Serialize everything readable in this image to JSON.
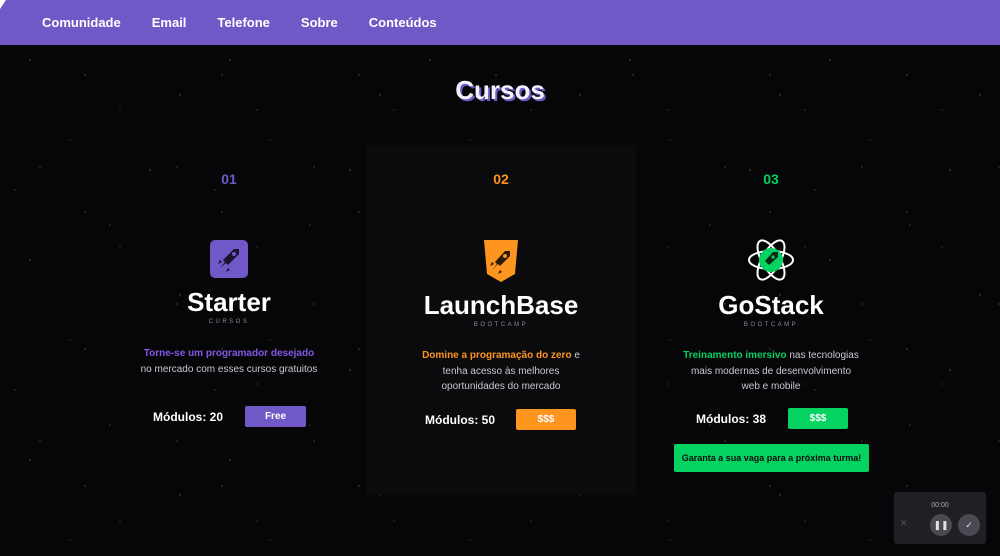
{
  "nav": {
    "items": [
      "Comunidade",
      "Email",
      "Telefone",
      "Sobre",
      "Conteúdos"
    ]
  },
  "page_title": "Cursos",
  "colors": {
    "navbar": "#7158c7",
    "starter_accent": "#8257e5",
    "launchbase_accent": "#fd951f",
    "gostack_accent": "#04d361"
  },
  "courses": [
    {
      "number": "01",
      "icon": "rocket-square-icon",
      "name": "Starter",
      "subtitle": "CURSOS",
      "desc_highlight": "Torne-se um programador desejado",
      "desc_rest": " no mercado com esses cursos gratuitos",
      "modules": "Módulos: 20",
      "price": "Free"
    },
    {
      "number": "02",
      "icon": "rocket-shield-icon",
      "name": "LaunchBase",
      "subtitle": "BOOTCAMP",
      "desc_highlight": "Domine a programação do zero",
      "desc_rest": " e tenha acesso às melhores oportunidades do mercado",
      "modules": "Módulos: 50",
      "price": "$$$"
    },
    {
      "number": "03",
      "icon": "rocket-atom-icon",
      "name": "GoStack",
      "subtitle": "BOOTCAMP",
      "desc_highlight": "Treinamento imersivo",
      "desc_rest": " nas tecnologias mais modernas de desenvolvimento web e mobile",
      "modules": "Módulos: 38",
      "price": "$$$",
      "cta": "Garanta a sua vaga para a próxima turma!"
    }
  ],
  "player": {
    "time": "00:00",
    "pause_icon": "pause-icon",
    "check_icon": "check-icon",
    "close_icon": "close-icon"
  }
}
